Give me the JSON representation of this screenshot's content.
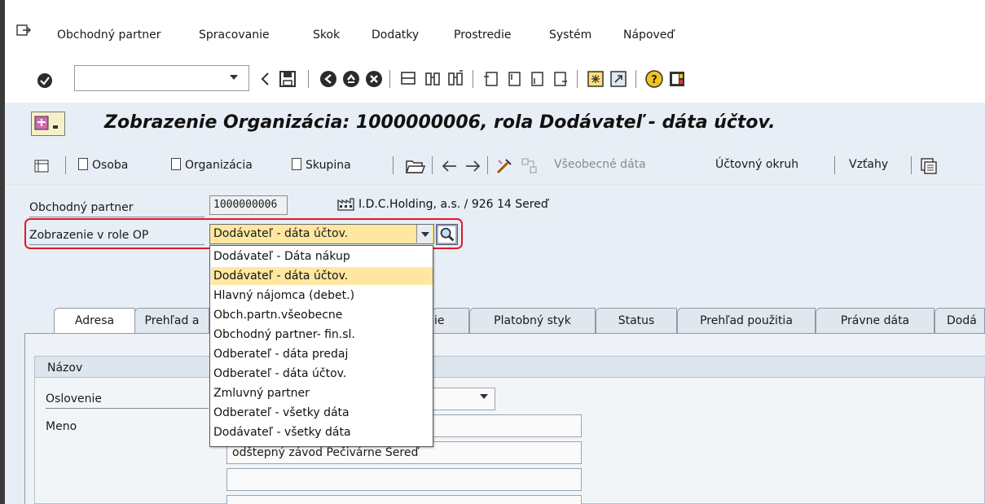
{
  "menu": {
    "items": [
      "Obchodný partner",
      "Spracovanie",
      "Skok",
      "Dodatky",
      "Prostredie",
      "Systém",
      "Nápoveď"
    ]
  },
  "toolbar": {
    "command_value": "",
    "icons": [
      "back-arrow-icon",
      "save-icon",
      "back-icon",
      "exit-icon",
      "cancel-icon",
      "print-icon",
      "find-icon",
      "find-next-icon",
      "first-page-icon",
      "prev-page-icon",
      "next-page-icon",
      "last-page-icon",
      "new-session-icon",
      "shortcut-icon",
      "help-icon",
      "layout-icon"
    ]
  },
  "title": {
    "text": "Zobrazenie Organizácia: 1000000006, rola Dodávateľ - dáta účtov."
  },
  "app_toolbar": {
    "osoba": "Osoba",
    "organizacia": "Organizácia",
    "skupina": "Skupina",
    "vseobecne_data": "Všeobecné dáta",
    "uctovny_okruh": "Účtovný okruh",
    "vztahy": "Vzťahy"
  },
  "header": {
    "partner_label": "Obchodný partner",
    "partner_value": "1000000006",
    "partner_description": "I.D.C.Holding, a.s. / 926 14 Sereď",
    "role_label": "Zobrazenie v role OP",
    "role_value": "Dodávateľ - dáta účtov."
  },
  "dropdown": {
    "options": [
      "Dodávateľ - Dáta nákup",
      "Dodávateľ - dáta účtov.",
      "Hlavný nájomca (debet.)",
      "Obch.partn.všeobecne",
      "Obchodný partner- fin.sl.",
      "Odberateľ - dáta predaj",
      "Odberateľ - dáta účtov.",
      "Zmluvný partner",
      "Odberateľ - všetky dáta",
      "Dodávateľ - všetky dáta"
    ],
    "selected_index": 1
  },
  "tabs": [
    "Adresa",
    "Prehľad a",
    "ie",
    "Platobný styk",
    "Status",
    "Prehľad použitia",
    "Právne dáta",
    "Dodá"
  ],
  "active_tab": 0,
  "address_group": {
    "title": "Názov",
    "salutation_label": "Oslovenie",
    "name_label": "Meno",
    "name_line_2": "odštepný závod Pečivárne Sereď",
    "name_line_3": "",
    "name_line_4": ""
  },
  "colors": {
    "selection_yellow": "#ffe7a1",
    "highlight_red": "#e0182d",
    "panel_blue": "#e8eef5"
  }
}
